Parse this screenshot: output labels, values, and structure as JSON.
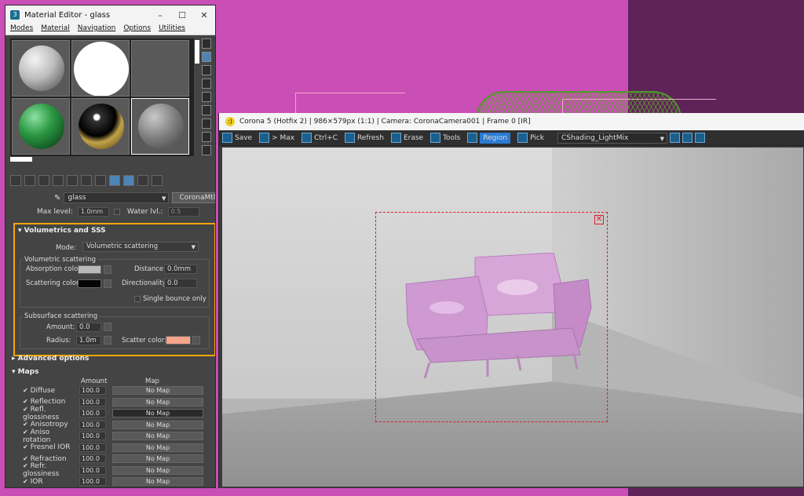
{
  "material_editor": {
    "title": "Material Editor - glass",
    "menu": [
      "Modes",
      "Material",
      "Navigation",
      "Options",
      "Utilities"
    ],
    "material_name": "glass",
    "material_type": "CoronaMtl",
    "max_level_label": "Max level:",
    "max_level_value": "1.0mm",
    "water_level_label": "Water lvl.:",
    "water_level_value": "0.5"
  },
  "sss": {
    "header": "Volumetrics and SSS",
    "mode_label": "Mode:",
    "mode_value": "Volumetric scattering",
    "volumetric_group": "Volumetric scattering",
    "absorption_label": "Absorption color:",
    "absorption_color": "#b9b9b9",
    "distance_label": "Distance:",
    "distance_value": "0.0mm",
    "scattering_label": "Scattering color:",
    "scattering_color": "#050505",
    "directionality_label": "Directionality:",
    "directionality_value": "0.0",
    "single_bounce_label": "Single bounce only",
    "subsurface_group": "Subsurface scattering",
    "amount_label": "Amount:",
    "amount_value": "0.0",
    "radius_label": "Radius:",
    "radius_value": "1.0m",
    "scatter_color_label": "Scatter color:",
    "scatter_color": "#f6a48a"
  },
  "advanced_header": "Advanced options",
  "maps": {
    "header": "Maps",
    "col_amount": "Amount",
    "col_map": "Map",
    "rows": [
      {
        "label": "Diffuse",
        "amount": "100.0",
        "map": "No Map"
      },
      {
        "label": "Reflection",
        "amount": "100.0",
        "map": "No Map"
      },
      {
        "label": "Refl. glossiness",
        "amount": "100.0",
        "map": "No Map"
      },
      {
        "label": "Anisotropy",
        "amount": "100.0",
        "map": "No Map"
      },
      {
        "label": "Aniso rotation",
        "amount": "100.0",
        "map": "No Map"
      },
      {
        "label": "Fresnel IOR",
        "amount": "100.0",
        "map": "No Map"
      },
      {
        "label": "Refraction",
        "amount": "100.0",
        "map": "No Map"
      },
      {
        "label": "Refr. glossiness",
        "amount": "100.0",
        "map": "No Map"
      },
      {
        "label": "IOR",
        "amount": "100.0",
        "map": "No Map"
      }
    ]
  },
  "vfb": {
    "title": "Corona 5 (Hotfix 2) | 986×579px (1:1) | Camera: CoronaCamera001 | Frame 0 [IR]",
    "save": "Save",
    "to_max": "> Max",
    "copy": "Ctrl+C",
    "refresh": "Refresh",
    "erase": "Erase",
    "tools": "Tools",
    "region": "Region",
    "pick": "Pick",
    "lightmix": "CShading_LightMix"
  }
}
